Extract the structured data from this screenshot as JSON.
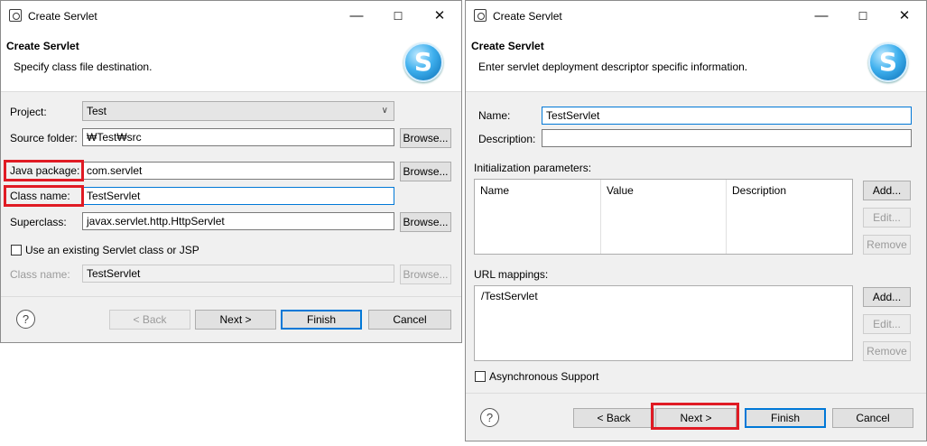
{
  "dialog1": {
    "title": "Create Servlet",
    "header_title": "Create Servlet",
    "header_desc": "Specify class file destination.",
    "logo_letter": "S",
    "project_label": "Project:",
    "project_value": "Test",
    "source_folder_label": "Source folder:",
    "source_folder_value": "₩Test₩src",
    "java_package_label": "Java package:",
    "java_package_value": "com.servlet",
    "class_name_label": "Class name:",
    "class_name_value": "TestServlet",
    "superclass_label": "Superclass:",
    "superclass_value": "javax.servlet.http.HttpServlet",
    "existing_checkbox_label": "Use an existing Servlet class or JSP",
    "existing_class_label": "Class name:",
    "existing_class_value": "TestServlet",
    "browse_label": "Browse...",
    "back_label": "< Back",
    "next_label": "Next >",
    "finish_label": "Finish",
    "cancel_label": "Cancel"
  },
  "dialog2": {
    "title": "Create Servlet",
    "header_title": "Create Servlet",
    "header_desc": "Enter servlet deployment descriptor specific information.",
    "logo_letter": "S",
    "name_label": "Name:",
    "name_value": "TestServlet",
    "description_label": "Description:",
    "description_value": "",
    "init_params_label": "Initialization parameters:",
    "columns": [
      "Name",
      "Value",
      "Description"
    ],
    "add_label": "Add...",
    "edit_label": "Edit...",
    "remove_label": "Remove",
    "url_mappings_label": "URL mappings:",
    "url_mappings": [
      "/TestServlet"
    ],
    "async_label": "Asynchronous Support",
    "back_label": "< Back",
    "next_label": "Next >",
    "finish_label": "Finish",
    "cancel_label": "Cancel"
  },
  "window_controls": {
    "minimize": "—",
    "maximize": "☐",
    "close": "✕"
  },
  "help_glyph": "?",
  "colors": {
    "highlight": "#e01b24",
    "focus": "#0078d7"
  }
}
